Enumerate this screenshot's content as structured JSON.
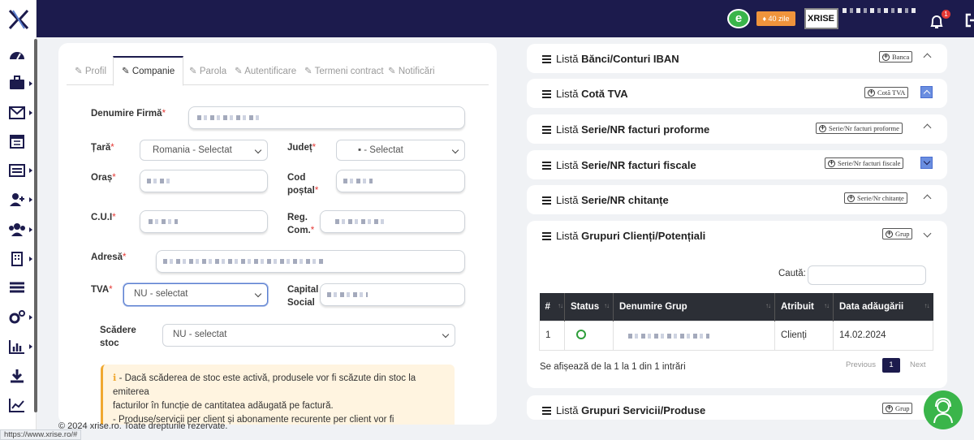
{
  "topbar": {
    "days_left": "40 zile",
    "brand_mini": "XRISE",
    "notifications_count": "1"
  },
  "tabs": [
    {
      "label": "Profil",
      "active": false
    },
    {
      "label": "Companie",
      "active": true
    },
    {
      "label": "Parola",
      "active": false
    },
    {
      "label": "Autentificare",
      "active": false
    },
    {
      "label": "Termeni contract",
      "active": false
    },
    {
      "label": "Notificări",
      "active": false
    }
  ],
  "form": {
    "denumire_label": "Denumire Firmă",
    "tara_label": "Țară",
    "tara_value": "Romania - Selectat",
    "judet_label": "Județ",
    "judet_value": "- Selectat",
    "oras_label": "Oraș",
    "cod_postal_label_1": "Cod",
    "cod_postal_label_2": "poștal",
    "cui_label": "C.U.I",
    "reg_com_label_1": "Reg.",
    "reg_com_label_2": "Com.",
    "adresa_label": "Adresă",
    "tva_label": "TVA",
    "tva_value": "NU - selectat",
    "capital_label_1": "Capital",
    "capital_label_2": "Social",
    "scadere_label_1": "Scădere",
    "scadere_label_2": "stoc",
    "scadere_value": "NU - selectat",
    "required_mark": "*"
  },
  "alert": {
    "icon": "info-icon",
    "line1": " - Dacă scăderea de stoc este activă, produsele vor fi scăzute din stoc la emiterea",
    "line2": "facturilor în funcție de cantitatea adăugată pe factură.",
    "line3": "- Produse/servicii per client și abonamente recurente per client vor fi dezactivate."
  },
  "footer": {
    "copyright": "© 2024 xrise.ro. Toate drepturile rezervate.",
    "status_url": "https://www.xrise.ro/#"
  },
  "panels": [
    {
      "prefix": "Listă ",
      "title": "Bănci/Conturi IBAN",
      "button": "Banca",
      "toggle": "up"
    },
    {
      "prefix": "Listă ",
      "title": "Cotă TVA",
      "button": "Cotă TVA",
      "toggle": "up-active"
    },
    {
      "prefix": "Listă ",
      "title": "Serie/NR facturi proforme",
      "button": "Serie/Nr facturi proforme",
      "toggle": "up"
    },
    {
      "prefix": "Listă ",
      "title": "Serie/NR facturi fiscale",
      "button": "Serie/Nr facturi fiscale",
      "toggle": "down-active"
    },
    {
      "prefix": "Listă ",
      "title": "Serie/NR chitanțe",
      "button": "Serie/Nr chitanțe",
      "toggle": "up"
    },
    {
      "prefix": "Listă ",
      "title": "Grupuri Clienți/Potențiali",
      "button": "Grup",
      "toggle": "down"
    },
    {
      "prefix": "Listă ",
      "title": "Grupuri Servicii/Produse",
      "button": "Grup",
      "toggle": "none"
    }
  ],
  "group_table": {
    "search_label": "Caută:",
    "headers": [
      "#",
      "Status",
      "Denumire Grup",
      "Atribuit",
      "Data adăugării"
    ],
    "rows": [
      {
        "num": "1",
        "status": "active",
        "name": "",
        "assigned": "Clienți",
        "date": "14.02.2024"
      }
    ],
    "info": "Se afișează de la 1 la 1 din 1 intrări",
    "prev": "Previous",
    "page": "1",
    "next": "Next"
  },
  "colors": {
    "navy": "#1c1b4d",
    "green": "#3ab54a",
    "orange": "#f0943c",
    "accent_blue": "#6a8ee0"
  }
}
